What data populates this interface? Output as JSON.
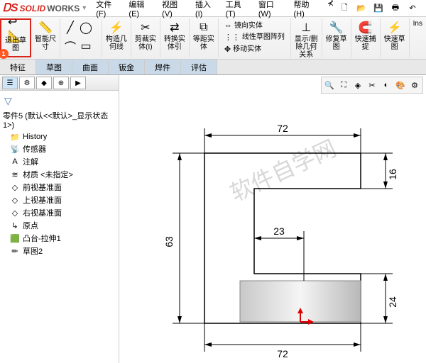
{
  "logo": {
    "brand1": "SOLID",
    "brand2": "WORKS"
  },
  "menu": [
    "文件(F)",
    "编辑(E)",
    "视图(V)",
    "插入(I)",
    "工具(T)",
    "窗口(W)",
    "帮助(H)"
  ],
  "ribbon": {
    "exit_sketch": "退出草\n图",
    "smart_dim": "智能尺\n寸",
    "convert": "转换实\n体引",
    "trim": "剪裁实\n体(I)",
    "offset": "等距实\n体",
    "mirror": "镜向实体",
    "lin_pattern": "线性草图阵列",
    "move": "移动实体",
    "display": "显示/删\n除几何\n关系",
    "repair": "修复草\n图",
    "snap": "快速捕\n捉",
    "rapid": "快速草\n图",
    "construct": "构造几\n何线",
    "inst": "Ins"
  },
  "badge": "1",
  "tabs": [
    "特征",
    "草图",
    "曲面",
    "钣金",
    "焊件",
    "评估"
  ],
  "tree": {
    "title": "零件5  (默认<<默认>_显示状态 1>)",
    "items": [
      {
        "icon": "📁",
        "label": "History"
      },
      {
        "icon": "📡",
        "label": "传感器"
      },
      {
        "icon": "A",
        "label": "注解"
      },
      {
        "icon": "≋",
        "label": "材质 <未指定>"
      },
      {
        "icon": "◇",
        "label": "前视基准面"
      },
      {
        "icon": "◇",
        "label": "上视基准面"
      },
      {
        "icon": "◇",
        "label": "右视基准面"
      },
      {
        "icon": "↳",
        "label": "原点"
      },
      {
        "icon": "🟩",
        "label": "凸台-拉伸1"
      },
      {
        "icon": "✏",
        "label": "草图2"
      }
    ]
  },
  "dims": {
    "top": "72",
    "bottom": "72",
    "left": "63",
    "mid": "23",
    "right_top": "16",
    "right_bot": "24"
  },
  "watermark": "软件自学网"
}
